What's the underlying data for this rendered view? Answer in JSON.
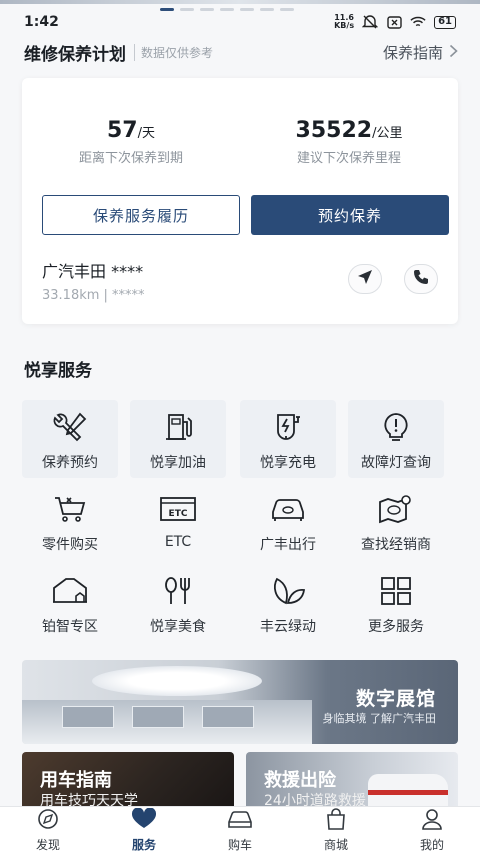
{
  "status_bar": {
    "time": "1:42",
    "net_speed_value": "11.6",
    "net_speed_unit": "KB/s",
    "battery": "61"
  },
  "plan": {
    "title": "维修保养计划",
    "note": "数据仅供参考",
    "guide_link": "保养指南"
  },
  "maintenance": {
    "days_value": "57",
    "days_unit": "/天",
    "days_caption": "距离下次保养到期",
    "mileage_value": "35522",
    "mileage_unit": "/公里",
    "mileage_caption": "建议下次保养里程",
    "history_button": "保养服务履历",
    "book_button": "预约保养",
    "dealer_name": "广汽丰田 ****",
    "dealer_meta": "33.18km | *****"
  },
  "services": {
    "title": "悦享服务",
    "items": [
      {
        "label": "保养预约",
        "icon": "wrench-screwdriver-icon"
      },
      {
        "label": "悦享加油",
        "icon": "fuel-pump-icon"
      },
      {
        "label": "悦享充电",
        "icon": "charging-station-icon"
      },
      {
        "label": "故障灯查询",
        "icon": "warning-light-icon"
      },
      {
        "label": "零件购买",
        "icon": "parts-cart-icon"
      },
      {
        "label": "ETC",
        "icon": "etc-card-icon"
      },
      {
        "label": "广丰出行",
        "icon": "car-front-icon"
      },
      {
        "label": "查找经销商",
        "icon": "dealer-map-icon"
      },
      {
        "label": "铂智专区",
        "icon": "garage-icon"
      },
      {
        "label": "悦享美食",
        "icon": "fork-knife-icon"
      },
      {
        "label": "丰云绿动",
        "icon": "leaf-icon"
      },
      {
        "label": "更多服务",
        "icon": "grid-more-icon"
      }
    ]
  },
  "museum_banner": {
    "title": "数字展馆",
    "subtitle": "身临其境 了解广汽丰田"
  },
  "promos": [
    {
      "title": "用车指南",
      "subtitle": "用车技巧天天学"
    },
    {
      "title": "救援出险",
      "subtitle": "24小时道路救援"
    }
  ],
  "tabbar": {
    "items": [
      {
        "label": "发现",
        "icon": "compass-icon"
      },
      {
        "label": "服务",
        "icon": "heart-icon"
      },
      {
        "label": "购车",
        "icon": "car-icon"
      },
      {
        "label": "商城",
        "icon": "shopping-bag-icon"
      },
      {
        "label": "我的",
        "icon": "user-icon"
      }
    ],
    "active": "服务"
  },
  "colors": {
    "primary": "#2a4b78",
    "background": "#f6f7f9",
    "tile_background": "#edf0f4"
  }
}
